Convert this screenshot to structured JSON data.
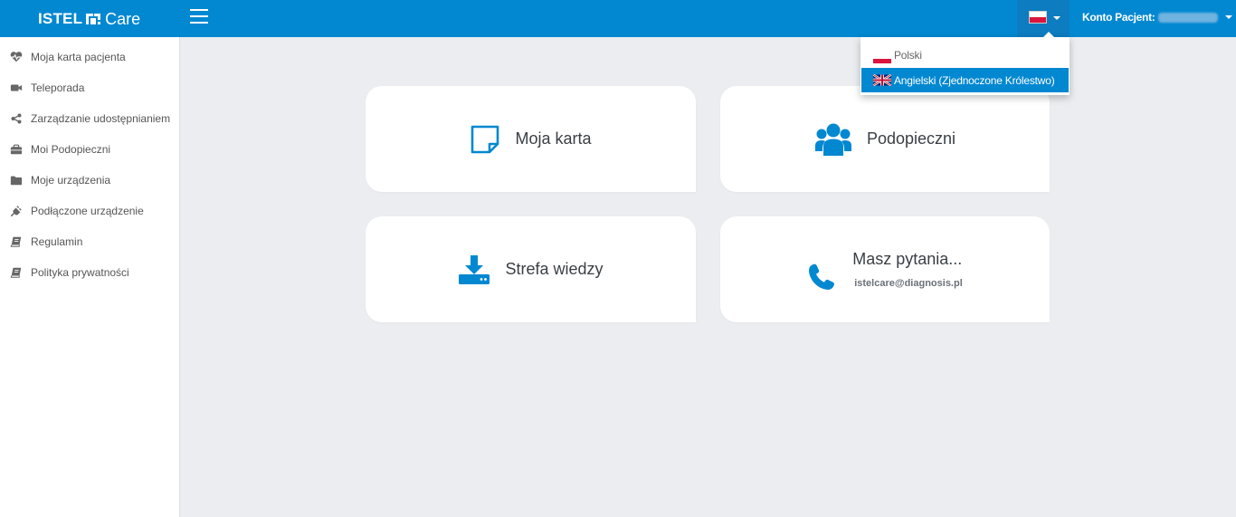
{
  "header": {
    "brand": "ISTEL",
    "brand_suffix": "Care",
    "account_label": "Konto Pacjent:",
    "colors": {
      "bar": "#0288d1",
      "lang_button": "#0d7cc0"
    }
  },
  "sidebar": {
    "items": [
      {
        "label": "Moja karta pacjenta",
        "icon": "heartbeat-icon"
      },
      {
        "label": "Teleporada",
        "icon": "video-camera-icon"
      },
      {
        "label": "Zarządzanie udostępnianiem",
        "icon": "share-icon"
      },
      {
        "label": "Moi Podopieczni",
        "icon": "briefcase-icon"
      },
      {
        "label": "Moje urządzenia",
        "icon": "folder-icon"
      },
      {
        "label": "Podłączone urządzenie",
        "icon": "plug-icon"
      },
      {
        "label": "Regulamin",
        "icon": "book-icon"
      },
      {
        "label": "Polityka prywatności",
        "icon": "book-icon"
      }
    ]
  },
  "cards": [
    {
      "title": "Moja karta",
      "icon": "sticky-note-icon"
    },
    {
      "title": "Podopieczni",
      "icon": "users-icon"
    },
    {
      "title": "Strefa wiedzy",
      "icon": "download-icon"
    },
    {
      "title": "Masz pytania...",
      "subtitle": "istelcare@diagnosis.pl",
      "icon": "phone-icon"
    }
  ],
  "language_menu": {
    "selected": "Angielski (Zjednoczone Królestwo)",
    "options": [
      {
        "label": "Polski",
        "flag": "poland-flag-icon"
      },
      {
        "label": "Angielski (Zjednoczone Królestwo)",
        "flag": "uk-flag-icon"
      }
    ]
  },
  "colors": {
    "accent": "#0288d1",
    "background": "#ebedf0",
    "card": "#ffffff"
  }
}
